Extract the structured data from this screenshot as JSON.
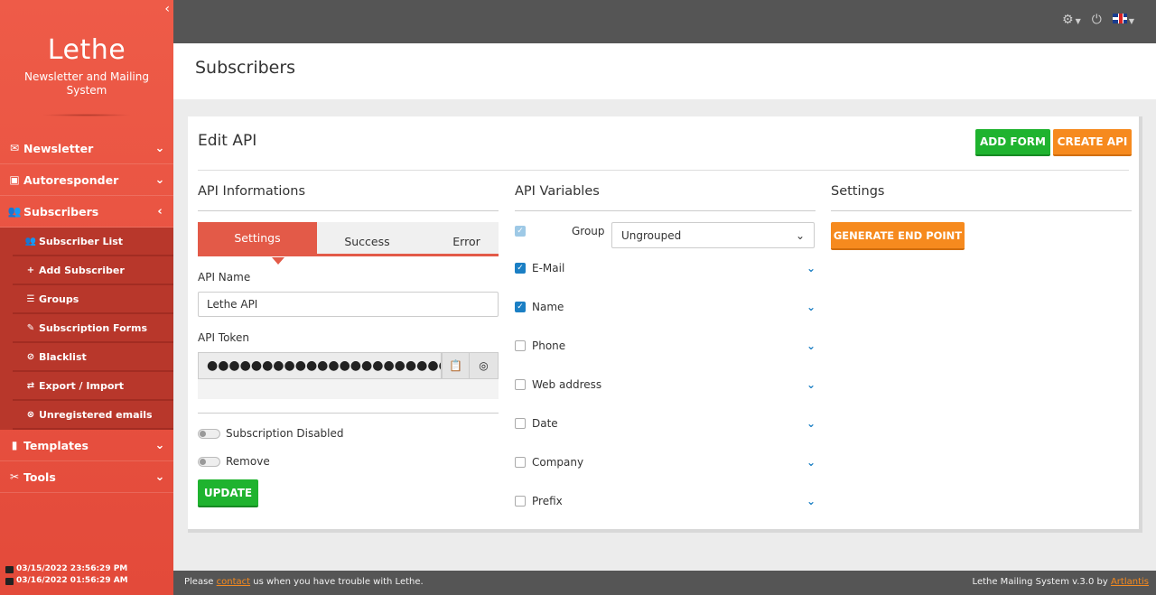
{
  "brand": {
    "title": "Lethe",
    "subtitle": "Newsletter and Mailing System"
  },
  "sidebar": {
    "items": [
      {
        "label": "Newsletter",
        "icon": "envelope-icon"
      },
      {
        "label": "Autoresponder",
        "icon": "robot-icon"
      },
      {
        "label": "Subscribers",
        "icon": "users-icon"
      },
      {
        "label": "Templates",
        "icon": "paint-roller-icon"
      },
      {
        "label": "Tools",
        "icon": "tools-icon"
      }
    ],
    "subitems": [
      {
        "label": "Subscriber List",
        "icon": "users-icon"
      },
      {
        "label": "Add Subscriber",
        "icon": "plus-icon"
      },
      {
        "label": "Groups",
        "icon": "list-icon"
      },
      {
        "label": "Subscription Forms",
        "icon": "edit-icon"
      },
      {
        "label": "Blacklist",
        "icon": "ban-icon"
      },
      {
        "label": "Export / Import",
        "icon": "exchange-icon"
      },
      {
        "label": "Unregistered emails",
        "icon": "user-slash-icon"
      }
    ],
    "dates": [
      "03/15/2022 23:56:29 PM",
      "03/16/2022 01:56:29 AM"
    ]
  },
  "header": {
    "title": "Subscribers"
  },
  "panel": {
    "title": "Edit API",
    "add_form": "ADD FORM",
    "create_api": "CREATE API"
  },
  "api_info": {
    "title": "API Informations",
    "tabs": [
      "Settings",
      "Success",
      "Error"
    ],
    "name_label": "API Name",
    "name_value": "Lethe API",
    "token_label": "API Token",
    "token_value": "●●●●●●●●●●●●●●●●●●●●●●●●●●●●●●●●",
    "subscription_disabled": "Subscription Disabled",
    "remove": "Remove",
    "update": "UPDATE"
  },
  "api_vars": {
    "title": "API Variables",
    "group_label": "Group",
    "group_value": "Ungrouped",
    "vars": [
      {
        "label": "E-Mail",
        "checked": true
      },
      {
        "label": "Name",
        "checked": true
      },
      {
        "label": "Phone",
        "checked": false
      },
      {
        "label": "Web address",
        "checked": false
      },
      {
        "label": "Date",
        "checked": false
      },
      {
        "label": "Company",
        "checked": false
      },
      {
        "label": "Prefix",
        "checked": false
      }
    ]
  },
  "settings": {
    "title": "Settings",
    "generate": "GENERATE END POINT"
  },
  "footer": {
    "left_pre": "Please",
    "left_link": "contact",
    "left_post": "us when you have trouble with Lethe.",
    "right_pre": "Lethe Mailing System v.3.0 by",
    "right_link": "Artlantis"
  }
}
